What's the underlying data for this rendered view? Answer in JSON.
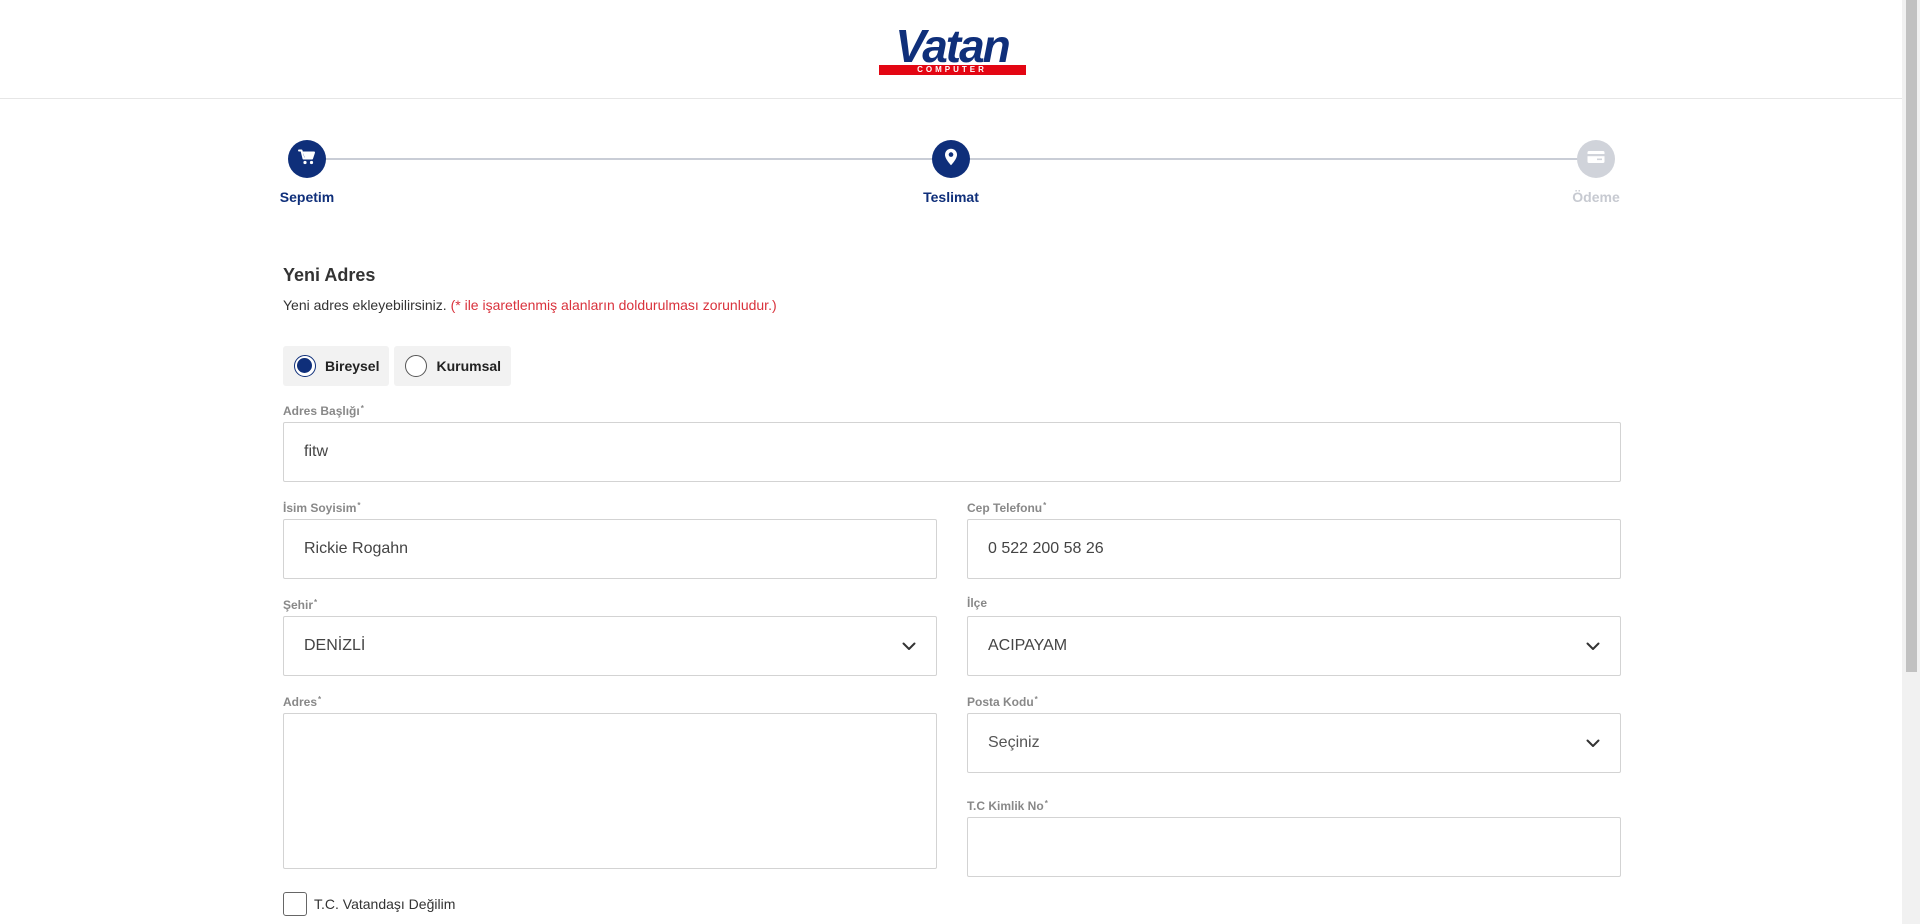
{
  "brand": {
    "logo_text": "Vatan",
    "logo_subtext": "COMPUTER",
    "primary_color": "#0f2f7a",
    "accent_color": "#e30613",
    "required_note_color": "#d9323c"
  },
  "stepper": {
    "steps": [
      {
        "label": "Sepetim",
        "icon": "cart-icon",
        "state": "done"
      },
      {
        "label": "Teslimat",
        "icon": "location-pin-icon",
        "state": "active"
      },
      {
        "label": "Ödeme",
        "icon": "credit-card-icon",
        "state": "inactive"
      }
    ]
  },
  "form": {
    "title": "Yeni Adres",
    "description": "Yeni adres ekleyebilirsiniz.",
    "required_note": "(* ile işaretlenmiş alanların doldurulması zorunludur.)",
    "address_type": {
      "options": [
        "Bireysel",
        "Kurumsal"
      ],
      "selected": "Bireysel"
    },
    "fields": {
      "address_title": {
        "label": "Adres Başlığı",
        "required": "*",
        "value": "fitw"
      },
      "full_name": {
        "label": "İsim Soyisim",
        "required": "*",
        "value": "Rickie Rogahn"
      },
      "phone": {
        "label": "Cep Telefonu",
        "required": "*",
        "value": "0 522 200 58 26"
      },
      "city": {
        "label": "Şehir",
        "required": "*",
        "value": "DENİZLİ"
      },
      "district": {
        "label": "İlçe",
        "value": "ACIPAYAM"
      },
      "address": {
        "label": "Adres",
        "required": "*",
        "value": ""
      },
      "postal_code": {
        "label": "Posta Kodu",
        "required": "*",
        "value": "Seçiniz"
      },
      "tc_id": {
        "label": "T.C Kimlik No",
        "required": "*",
        "value": ""
      }
    },
    "not_citizen_label": "T.C. Vatandaşı Değilim"
  }
}
